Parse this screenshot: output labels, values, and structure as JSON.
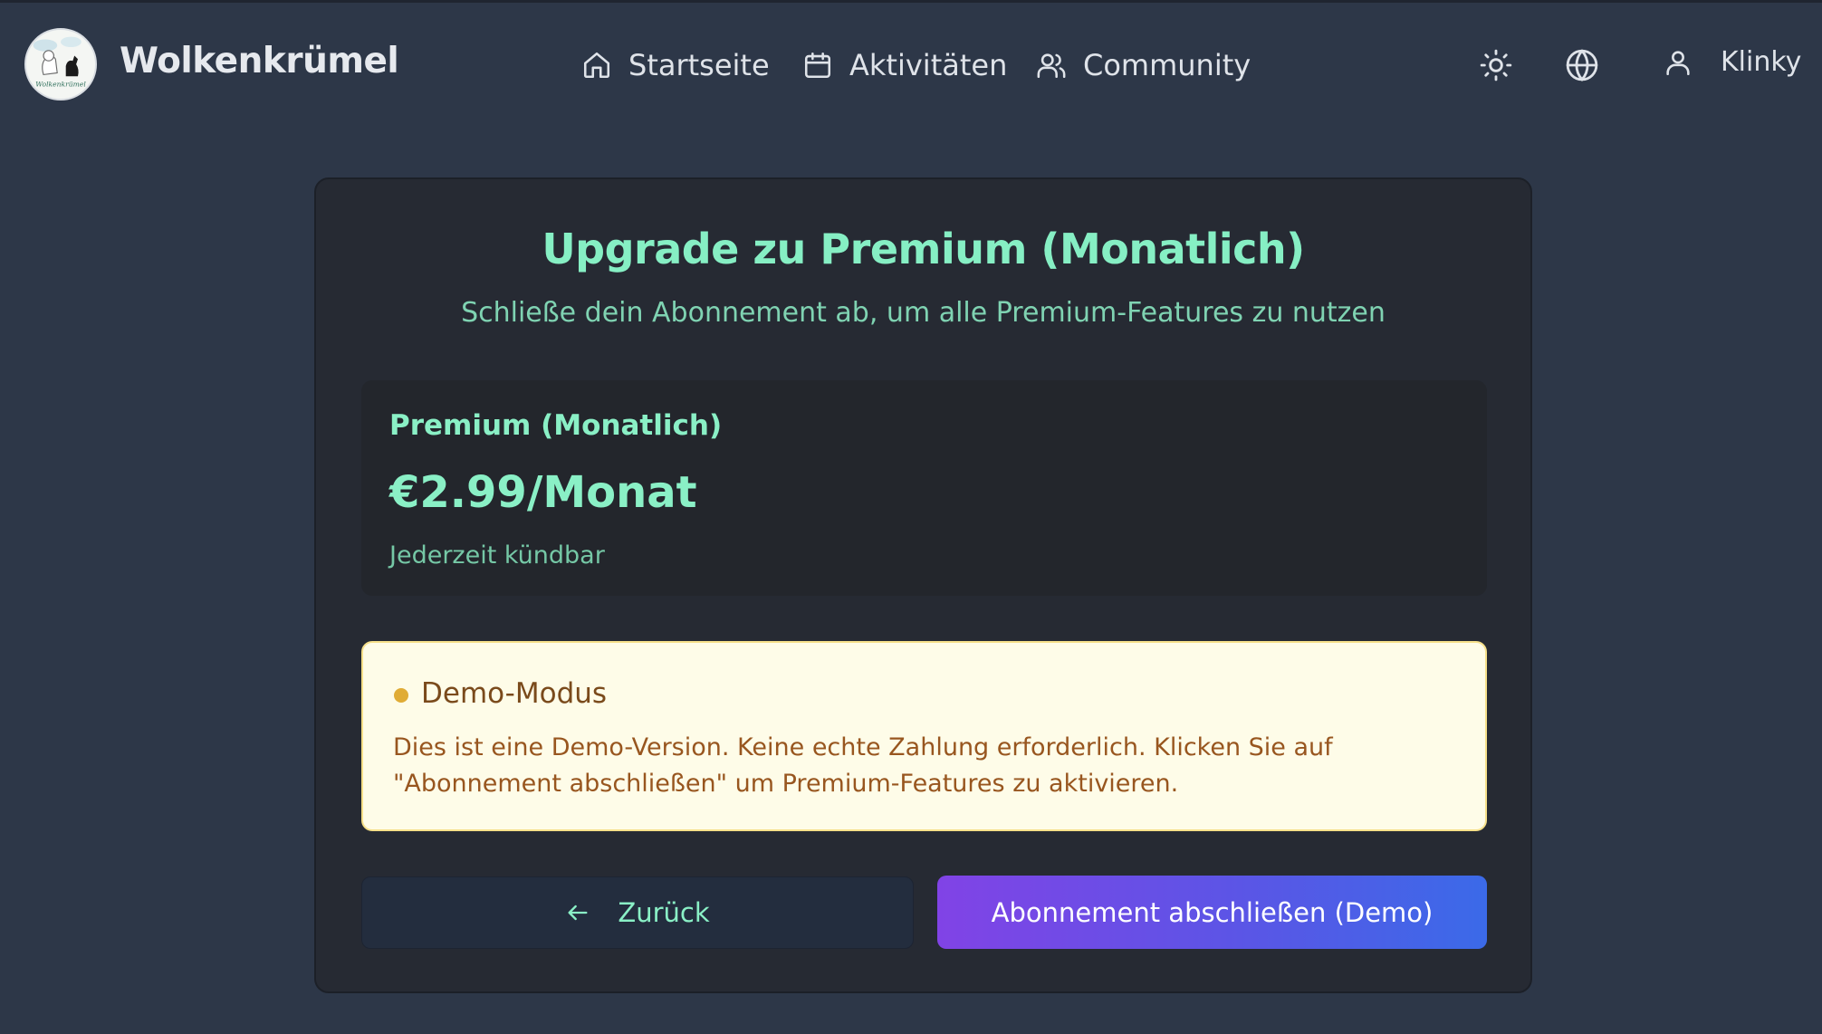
{
  "header": {
    "brand": "Wolkenkrümel",
    "logo_text": "Wolkenkrümel",
    "nav": [
      {
        "label": "Startseite",
        "icon": "home-icon"
      },
      {
        "label": "Aktivitäten",
        "icon": "calendar-icon"
      },
      {
        "label": "Community",
        "icon": "users-icon"
      }
    ],
    "icons": [
      "sun-icon",
      "globe-icon",
      "user-icon"
    ],
    "user_name": "Klinky"
  },
  "main": {
    "title": "Upgrade zu Premium (Monatlich)",
    "subtitle": "Schließe dein Abonnement ab, um alle Premium-Features zu nutzen",
    "plan": {
      "name": "Premium (Monatlich)",
      "price": "€2.99/Monat",
      "note": "Jederzeit kündbar"
    },
    "demo": {
      "title": "Demo-Modus",
      "text": "Dies ist eine Demo-Version. Keine echte Zahlung erforderlich. Klicken Sie auf \"Abonnement abschließen\" um Premium-Features zu aktivieren."
    },
    "buttons": {
      "back": "Zurück",
      "subscribe": "Abonnement abschließen (Demo)"
    }
  },
  "colors": {
    "background": "#2d3748",
    "card": "#262a33",
    "accent_green": "#86efc4",
    "demo_bg": "#fefce8",
    "demo_text": "#98561f",
    "button_gradient_start": "#8143e6",
    "button_gradient_end": "#3b6ae8"
  }
}
